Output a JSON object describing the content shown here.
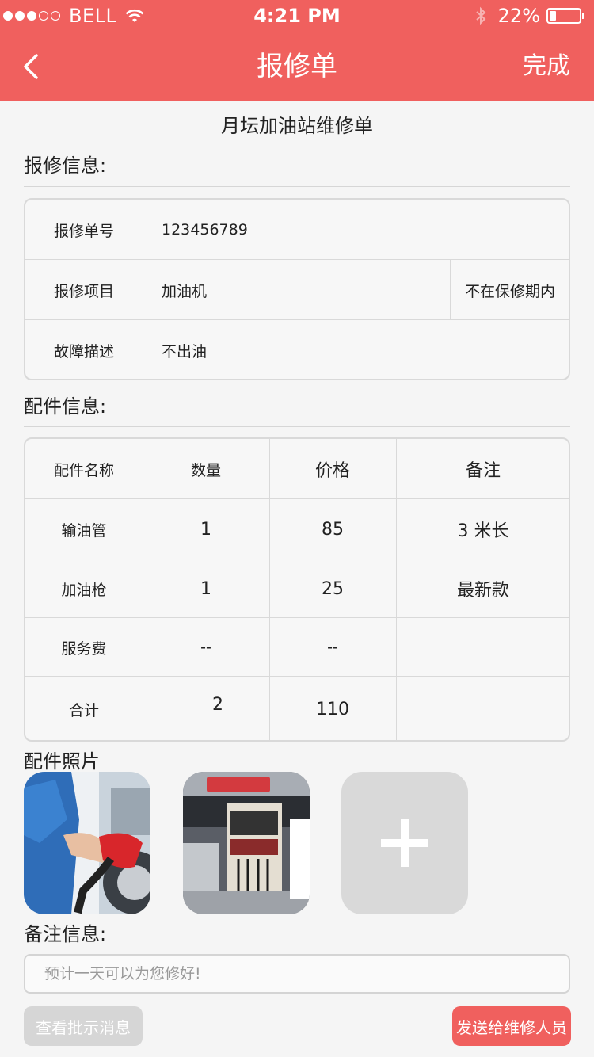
{
  "status_bar": {
    "carrier": "BELL",
    "time": "4:21 PM",
    "battery": "22%",
    "battery_level": 0.22,
    "signal_bars": 3,
    "signal_total": 5
  },
  "nav": {
    "back_icon": "chevron-left-icon",
    "title": "报修单",
    "done_label": "完成"
  },
  "doc_title": "月坛加油站维修单",
  "repair_info": {
    "label": "报修信息:",
    "rows": [
      {
        "key": "报修单号",
        "value": "123456789"
      },
      {
        "key": "报修项目",
        "value": "加油机",
        "extra": "不在保修期内"
      },
      {
        "key": "故障描述",
        "value": "不出油"
      }
    ]
  },
  "parts_info": {
    "label": "配件信息:",
    "headers": [
      "配件名称",
      "数量",
      "价格",
      "备注"
    ],
    "rows": [
      [
        "输油管",
        "1",
        "85",
        "3 米长"
      ],
      [
        "加油枪",
        "1",
        "25",
        "最新款"
      ],
      [
        "服务费",
        "--",
        "--",
        ""
      ],
      [
        "合计",
        "2",
        "110",
        ""
      ]
    ]
  },
  "photos": {
    "label": "配件照片",
    "add_icon": "plus-icon"
  },
  "notes": {
    "label": "备注信息:",
    "placeholder": "预计一天可以为您修好!"
  },
  "buttons": {
    "view_messages": "查看批示消息",
    "send": "发送给维修人员"
  },
  "colors": {
    "accent": "#f0605e",
    "background": "#f5f5f5",
    "disabled": "#d6d6d6"
  }
}
